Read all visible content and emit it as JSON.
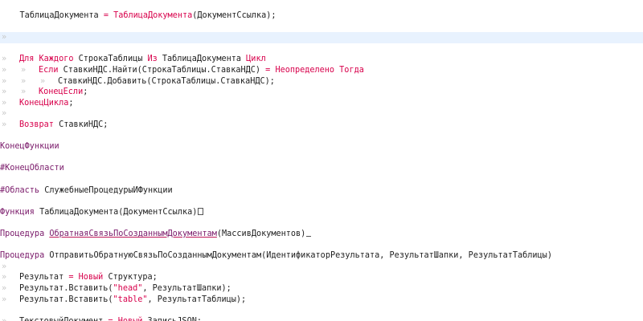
{
  "editor": {
    "colors": {
      "keyword": "#d8004b",
      "keyword_alt": "#7a1a6a",
      "identifier": "#1e1e1e",
      "method_underline": "#c0185a",
      "tab_marker": "#c8c8c8",
      "current_line_bg": "#e8f2fe"
    },
    "lines": [
      {
        "tokens": [
          {
            "t": "    "
          },
          {
            "t": "ТаблицаДокумента",
            "c": "id"
          },
          {
            "t": " = ",
            "c": "op"
          },
          {
            "t": "ТаблицаДокумента",
            "c": "fn"
          },
          {
            "t": "(ДокументСсылка);",
            "c": "id"
          }
        ]
      },
      {
        "tokens": []
      },
      {
        "tokens": [
          {
            "tab": "»"
          }
        ],
        "current": true
      },
      {
        "tokens": []
      },
      {
        "tokens": [
          {
            "tab": "»"
          },
          {
            "t": "Для Каждого ",
            "c": "kw"
          },
          {
            "t": "СтрокаТаблицы ",
            "c": "id"
          },
          {
            "t": "Из ",
            "c": "kw"
          },
          {
            "t": "ТаблицаДокумента ",
            "c": "id"
          },
          {
            "t": "Цикл",
            "c": "kw"
          }
        ]
      },
      {
        "tokens": [
          {
            "tab": "»"
          },
          {
            "tab": "»"
          },
          {
            "t": "Если ",
            "c": "kw"
          },
          {
            "t": "СтавкиНДС.Найти(СтрокаТаблицы.СтавкаНДС) ",
            "c": "id"
          },
          {
            "t": "= ",
            "c": "op"
          },
          {
            "t": "Неопределено ",
            "c": "kw"
          },
          {
            "t": "Тогда",
            "c": "kw"
          }
        ]
      },
      {
        "tokens": [
          {
            "tab": "»"
          },
          {
            "tab": "»"
          },
          {
            "tab": "»"
          },
          {
            "t": "СтавкиНДС.Добавить(СтрокаТаблицы.СтавкаНДС);",
            "c": "id"
          }
        ]
      },
      {
        "tokens": [
          {
            "tab": "»"
          },
          {
            "tab": "»"
          },
          {
            "t": "КонецЕсли",
            "c": "kw"
          },
          {
            "t": ";",
            "c": "id"
          }
        ]
      },
      {
        "tokens": [
          {
            "tab": "»"
          },
          {
            "t": "КонецЦикла",
            "c": "kw"
          },
          {
            "t": ";",
            "c": "id"
          }
        ]
      },
      {
        "tokens": [
          {
            "tab": "»"
          }
        ]
      },
      {
        "tokens": [
          {
            "tab": "»"
          },
          {
            "t": "Возврат ",
            "c": "kw"
          },
          {
            "t": "СтавкиНДС;",
            "c": "id"
          }
        ]
      },
      {
        "tokens": []
      },
      {
        "tokens": [
          {
            "t": "КонецФункции",
            "c": "kw2"
          }
        ]
      },
      {
        "tokens": []
      },
      {
        "tokens": [
          {
            "t": "#КонецОбласти",
            "c": "kw2"
          }
        ]
      },
      {
        "tokens": []
      },
      {
        "tokens": [
          {
            "t": "#Область ",
            "c": "kw2"
          },
          {
            "t": "СлужебныеПроцедурыИФункции",
            "c": "id"
          }
        ]
      },
      {
        "tokens": []
      },
      {
        "tokens": [
          {
            "t": "Функция ",
            "c": "kw2"
          },
          {
            "t": "ТаблицаДокумента(ДокументСсылка)",
            "c": "id"
          },
          {
            "fold": "box"
          }
        ]
      },
      {
        "tokens": []
      },
      {
        "tokens": [
          {
            "t": "Процедура ",
            "c": "kw2"
          },
          {
            "t": "ОбратнаяСвязьПоСозданнымДокументам",
            "c": "fnu"
          },
          {
            "t": "(МассивДокументов)",
            "c": "id"
          },
          {
            "fold": "underscore"
          }
        ]
      },
      {
        "tokens": []
      },
      {
        "tokens": [
          {
            "t": "Процедура ",
            "c": "kw2"
          },
          {
            "t": "ОтправитьОбратнуюСвязьПоСозданнымДокументам(ИдентификаторРезультата, РезультатШапки, РезультатТаблицы)",
            "c": "id"
          }
        ]
      },
      {
        "tokens": [
          {
            "tab": "»"
          }
        ]
      },
      {
        "tokens": [
          {
            "tab": "»"
          },
          {
            "t": "Результат ",
            "c": "id"
          },
          {
            "t": "= ",
            "c": "op"
          },
          {
            "t": "Новый ",
            "c": "kw"
          },
          {
            "t": "Структура;",
            "c": "id"
          }
        ]
      },
      {
        "tokens": [
          {
            "tab": "»"
          },
          {
            "t": "Результат.Вставить(",
            "c": "id"
          },
          {
            "t": "\"head\"",
            "c": "str"
          },
          {
            "t": ", РезультатШапки);",
            "c": "id"
          }
        ]
      },
      {
        "tokens": [
          {
            "tab": "»"
          },
          {
            "t": "Результат.Вставить(",
            "c": "id"
          },
          {
            "t": "\"table\"",
            "c": "str"
          },
          {
            "t": ", РезультатТаблицы);",
            "c": "id"
          }
        ]
      },
      {
        "tokens": []
      },
      {
        "tokens": [
          {
            "tab": "»"
          },
          {
            "t": "ТекстовыйДокумент ",
            "c": "id"
          },
          {
            "t": "= ",
            "c": "op"
          },
          {
            "t": "Новый ",
            "c": "kw"
          },
          {
            "t": "ЗаписьJSON;",
            "c": "id"
          }
        ]
      }
    ]
  }
}
